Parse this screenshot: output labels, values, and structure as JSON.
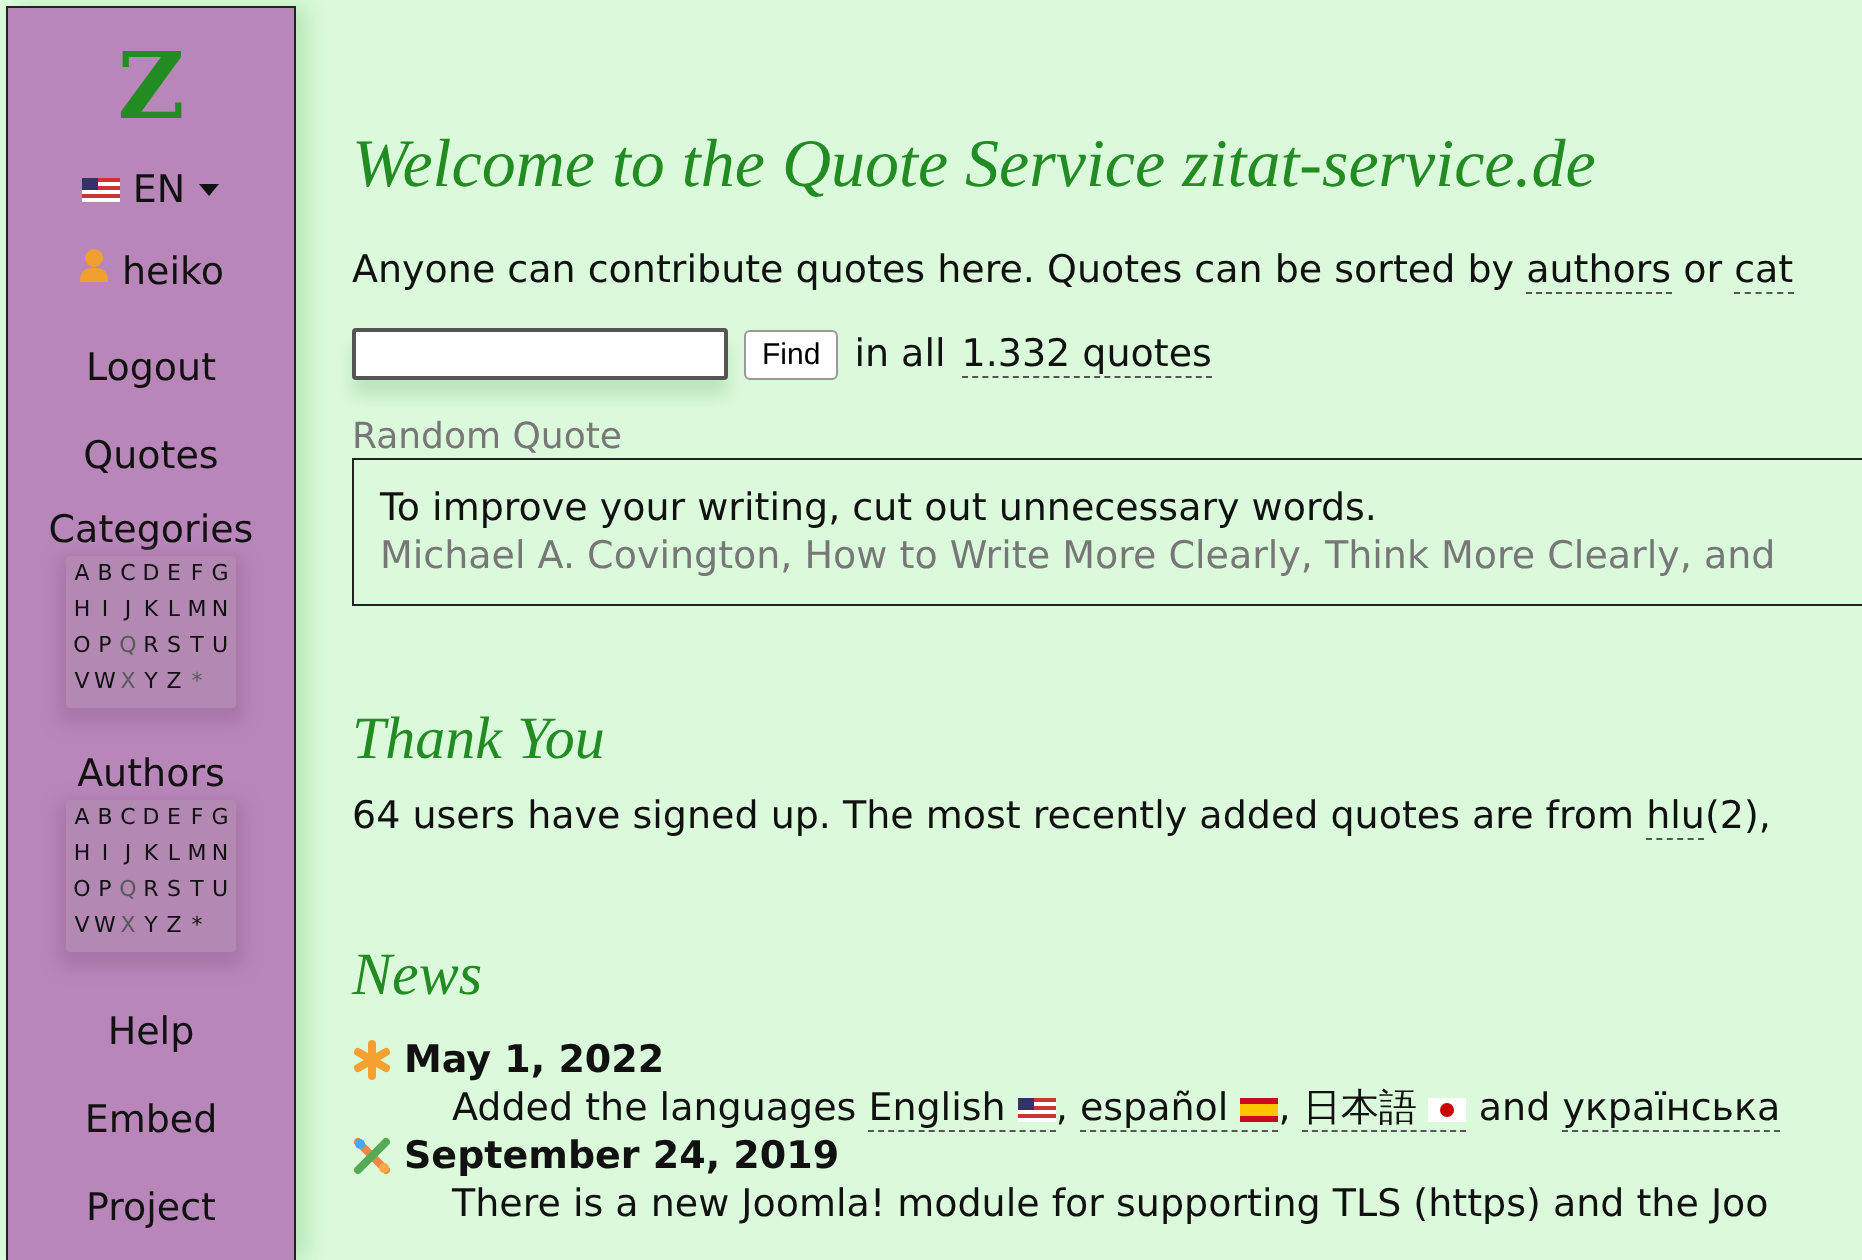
{
  "sidebar": {
    "logo": "Z",
    "language": {
      "label": "EN",
      "flag": true
    },
    "user": "heiko",
    "items_top": [
      {
        "label": "Logout"
      },
      {
        "label": "Quotes"
      }
    ],
    "indexes": [
      {
        "label": "Categories",
        "letters": [
          {
            "l": "A",
            "disabled": false
          },
          {
            "l": "B",
            "disabled": false
          },
          {
            "l": "C",
            "disabled": false
          },
          {
            "l": "D",
            "disabled": false
          },
          {
            "l": "E",
            "disabled": false
          },
          {
            "l": "F",
            "disabled": false
          },
          {
            "l": "G",
            "disabled": false
          },
          {
            "l": "H",
            "disabled": false
          },
          {
            "l": "I",
            "disabled": false
          },
          {
            "l": "J",
            "disabled": false
          },
          {
            "l": "K",
            "disabled": false
          },
          {
            "l": "L",
            "disabled": false
          },
          {
            "l": "M",
            "disabled": false
          },
          {
            "l": "N",
            "disabled": false
          },
          {
            "l": "O",
            "disabled": false
          },
          {
            "l": "P",
            "disabled": false
          },
          {
            "l": "Q",
            "disabled": true
          },
          {
            "l": "R",
            "disabled": false
          },
          {
            "l": "S",
            "disabled": false
          },
          {
            "l": "T",
            "disabled": false
          },
          {
            "l": "U",
            "disabled": false
          },
          {
            "l": "V",
            "disabled": false
          },
          {
            "l": "W",
            "disabled": false
          },
          {
            "l": "X",
            "disabled": true
          },
          {
            "l": "Y",
            "disabled": false
          },
          {
            "l": "Z",
            "disabled": false
          },
          {
            "l": "*",
            "disabled": true
          }
        ]
      },
      {
        "label": "Authors",
        "letters": [
          {
            "l": "A",
            "disabled": false
          },
          {
            "l": "B",
            "disabled": false
          },
          {
            "l": "C",
            "disabled": false
          },
          {
            "l": "D",
            "disabled": false
          },
          {
            "l": "E",
            "disabled": false
          },
          {
            "l": "F",
            "disabled": false
          },
          {
            "l": "G",
            "disabled": false
          },
          {
            "l": "H",
            "disabled": false
          },
          {
            "l": "I",
            "disabled": false
          },
          {
            "l": "J",
            "disabled": false
          },
          {
            "l": "K",
            "disabled": false
          },
          {
            "l": "L",
            "disabled": false
          },
          {
            "l": "M",
            "disabled": false
          },
          {
            "l": "N",
            "disabled": false
          },
          {
            "l": "O",
            "disabled": false
          },
          {
            "l": "P",
            "disabled": false
          },
          {
            "l": "Q",
            "disabled": true
          },
          {
            "l": "R",
            "disabled": false
          },
          {
            "l": "S",
            "disabled": false
          },
          {
            "l": "T",
            "disabled": false
          },
          {
            "l": "U",
            "disabled": false
          },
          {
            "l": "V",
            "disabled": false
          },
          {
            "l": "W",
            "disabled": false
          },
          {
            "l": "X",
            "disabled": true
          },
          {
            "l": "Y",
            "disabled": false
          },
          {
            "l": "Z",
            "disabled": false
          },
          {
            "l": "*",
            "disabled": false
          }
        ]
      }
    ],
    "items_bottom": [
      {
        "label": "Help"
      },
      {
        "label": "Embed"
      },
      {
        "label": "Project"
      }
    ]
  },
  "title": "Welcome to the Quote Service zitat-service.de",
  "intro": [
    {
      "kind": "text",
      "text": "Anyone can contribute quotes here. Quotes can be sorted by "
    },
    {
      "kind": "link",
      "text": "authors"
    },
    {
      "kind": "text",
      "text": " or "
    },
    {
      "kind": "link",
      "text": "cat"
    }
  ],
  "search": {
    "button": "Find",
    "prefix": "in all",
    "count_link": "1.332 quotes"
  },
  "random_quote": {
    "heading": "Random Quote",
    "quote": "To improve your writing, cut out unnecessary words.",
    "source": "Michael A. Covington, How to Write More Clearly, Think More Clearly, and"
  },
  "thanks": {
    "heading": "Thank You",
    "text": [
      {
        "kind": "text",
        "text": "64 users have signed up. The most recently added quotes are from "
      },
      {
        "kind": "link",
        "text": "hlu"
      },
      {
        "kind": "text",
        "text": "(2),"
      }
    ]
  },
  "news": {
    "heading": "News",
    "items": [
      {
        "kind": "asterisk",
        "date": "May 1, 2022",
        "text": [
          {
            "kind": "text",
            "text": "Added the languages "
          },
          {
            "kind": "flag_link",
            "text": "English"
          },
          {
            "kind": "text",
            "text": ", "
          },
          {
            "kind": "flag_link",
            "text": "español"
          },
          {
            "kind": "text",
            "text": ", "
          },
          {
            "kind": "flag_link",
            "text": "日本語"
          },
          {
            "kind": "text",
            "text": " and "
          },
          {
            "kind": "link",
            "text": "українська"
          }
        ]
      },
      {
        "kind": "cross",
        "date": "September 24, 2019",
        "text": [
          {
            "kind": "text",
            "text": "There is a new Joomla! module for supporting TLS (https) and the Joo"
          }
        ]
      }
    ]
  }
}
